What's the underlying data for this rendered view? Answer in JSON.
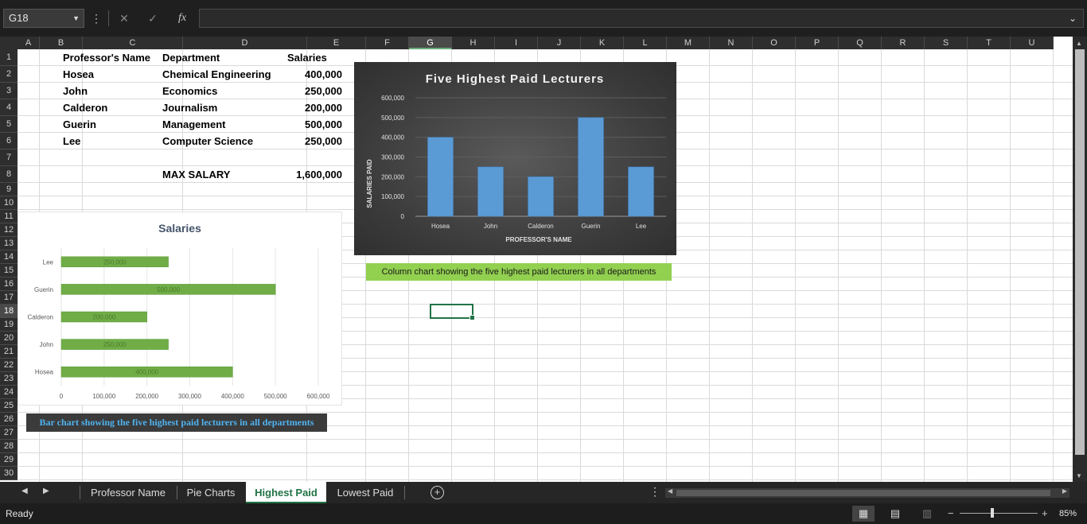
{
  "formula_bar": {
    "name_box": "G18",
    "cancel_icon": "✕",
    "enter_icon": "✓",
    "function_label": "fx",
    "formula_value": ""
  },
  "columns": [
    "A",
    "B",
    "C",
    "D",
    "E",
    "F",
    "G",
    "H",
    "I",
    "J",
    "K",
    "L",
    "M",
    "N",
    "O",
    "P",
    "Q",
    "R",
    "S",
    "T",
    "U"
  ],
  "selected_column": "G",
  "rows": [
    "1",
    "2",
    "3",
    "4",
    "5",
    "6",
    "7",
    "8",
    "9",
    "10",
    "11",
    "12",
    "13",
    "14",
    "15",
    "16",
    "17",
    "18",
    "19",
    "20",
    "21",
    "22",
    "23",
    "24",
    "25",
    "26",
    "27",
    "28",
    "29",
    "30"
  ],
  "selected_row": "18",
  "table": {
    "headers": {
      "name": "Professor's Name",
      "dept": "Department",
      "salary": "Salaries"
    },
    "rows": [
      {
        "name": "Hosea",
        "dept": "Chemical Engineering",
        "salary": "400,000"
      },
      {
        "name": "John",
        "dept": "Economics",
        "salary": "250,000"
      },
      {
        "name": "Calderon",
        "dept": "Journalism",
        "salary": "200,000"
      },
      {
        "name": "Guerin",
        "dept": "Management",
        "salary": "500,000"
      },
      {
        "name": "Lee",
        "dept": "Computer Science",
        "salary": "250,000"
      }
    ],
    "max_label": "MAX SALARY",
    "max_value": "1,600,000"
  },
  "chart_data": [
    {
      "type": "bar",
      "orientation": "vertical",
      "title": "Five Highest Paid Lecturers",
      "xlabel": "PROFESSOR'S NAME",
      "ylabel": "SALARIES PAID",
      "categories": [
        "Hosea",
        "John",
        "Calderon",
        "Guerin",
        "Lee"
      ],
      "values": [
        400000,
        250000,
        200000,
        500000,
        250000
      ],
      "ylim": [
        0,
        600000
      ],
      "yticks": [
        "0",
        "100,000",
        "200,000",
        "300,000",
        "400,000",
        "500,000",
        "600,000"
      ],
      "grid": true,
      "bar_color": "#5b9bd5",
      "background": "dark"
    },
    {
      "type": "bar",
      "orientation": "horizontal",
      "title": "Salaries",
      "categories": [
        "Lee",
        "Guerin",
        "Calderon",
        "John",
        "Hosea"
      ],
      "values": [
        250000,
        500000,
        200000,
        250000,
        400000
      ],
      "data_labels": [
        "250,000",
        "500,000",
        "200,000",
        "250,000",
        "400,000"
      ],
      "xlim": [
        0,
        600000
      ],
      "xticks": [
        "0",
        "100,000",
        "200,000",
        "300,000",
        "400,000",
        "500,000",
        "600,000"
      ],
      "grid": true,
      "bar_color": "#70ad47"
    }
  ],
  "captions": {
    "column_chart": "Column chart showing the five highest paid lecturers in all departments",
    "bar_chart": "Bar chart showing the five highest paid lecturers in all departments"
  },
  "sheets": [
    {
      "label": "Professor Name",
      "active": false
    },
    {
      "label": "Pie Charts",
      "active": false
    },
    {
      "label": "Highest Paid",
      "active": true
    },
    {
      "label": "Lowest Paid",
      "active": false
    }
  ],
  "status": {
    "ready": "Ready",
    "zoom": "85%",
    "zoom_minus": "−",
    "zoom_plus": "+"
  },
  "colors": {
    "accent": "#217346",
    "caption_green": "#92d050",
    "caption_blue": "#4fb3f0"
  }
}
